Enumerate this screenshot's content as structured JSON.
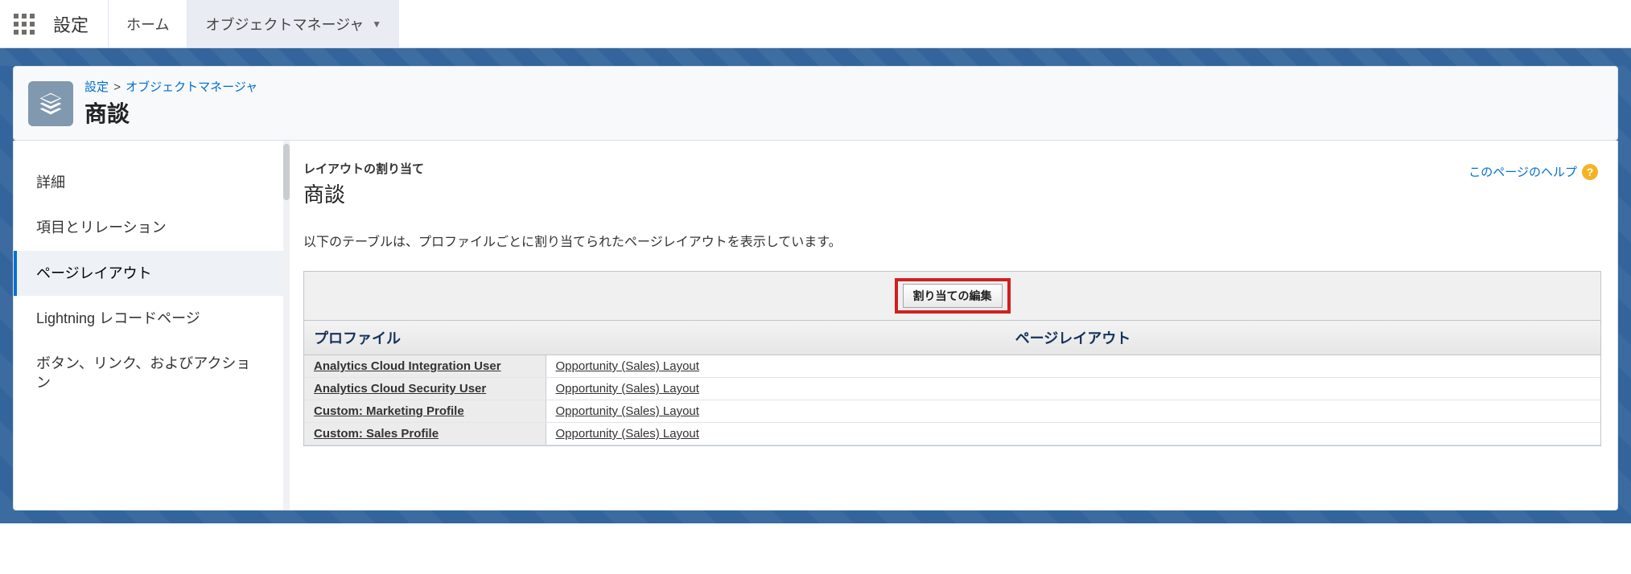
{
  "nav": {
    "title": "設定",
    "tabs": [
      {
        "label": "ホーム",
        "active": false
      },
      {
        "label": "オブジェクトマネージャ",
        "active": true
      }
    ]
  },
  "breadcrumb": {
    "root": "設定",
    "sep": ">",
    "parent": "オブジェクトマネージャ",
    "object_title": "商談"
  },
  "sidebar": {
    "items": [
      {
        "label": "詳細"
      },
      {
        "label": "項目とリレーション"
      },
      {
        "label": "ページレイアウト"
      },
      {
        "label": "Lightning レコードページ"
      },
      {
        "label": "ボタン、リンク、およびアクション"
      }
    ],
    "active_index": 2
  },
  "main": {
    "subhead": "レイアウトの割り当て",
    "title": "商談",
    "help_label": "このページのヘルプ",
    "description": "以下のテーブルは、プロファイルごとに割り当てられたページレイアウトを表示しています。",
    "edit_button": "割り当ての編集",
    "table": {
      "col_profile": "プロファイル",
      "col_layout": "ページレイアウト",
      "rows": [
        {
          "profile": "Analytics Cloud Integration User",
          "layout": "Opportunity (Sales) Layout"
        },
        {
          "profile": "Analytics Cloud Security User",
          "layout": "Opportunity (Sales) Layout"
        },
        {
          "profile": "Custom: Marketing Profile",
          "layout": "Opportunity (Sales) Layout"
        },
        {
          "profile": "Custom: Sales Profile",
          "layout": "Opportunity (Sales) Layout"
        }
      ]
    }
  }
}
